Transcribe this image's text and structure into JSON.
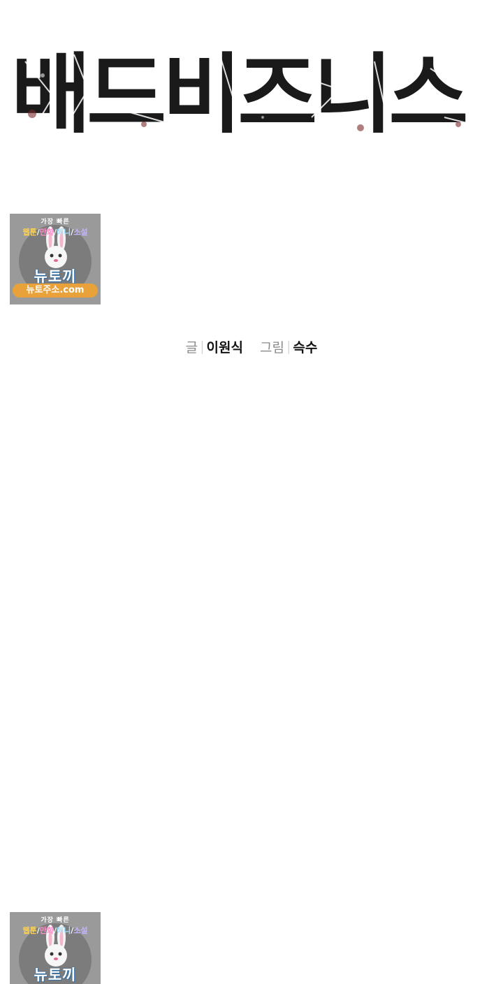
{
  "title": {
    "text": "배드비즈니스"
  },
  "watermark": {
    "kicker": "가장 빠른",
    "tags": [
      "웹툰",
      "만화",
      "애니",
      "소설"
    ],
    "brand": "뉴토끼",
    "url": "뉴토주소.com"
  },
  "credits": {
    "writer_label": "글",
    "separator": "|",
    "writer_name": "이원식",
    "artist_label": "그림",
    "artist_name": "슥수"
  },
  "colors": {
    "title_ink": "#1a1a1a",
    "title_blood": "#7a2a2a",
    "badge_bg": "#9a9a9a",
    "badge_url_bg": "#e9a23a"
  }
}
